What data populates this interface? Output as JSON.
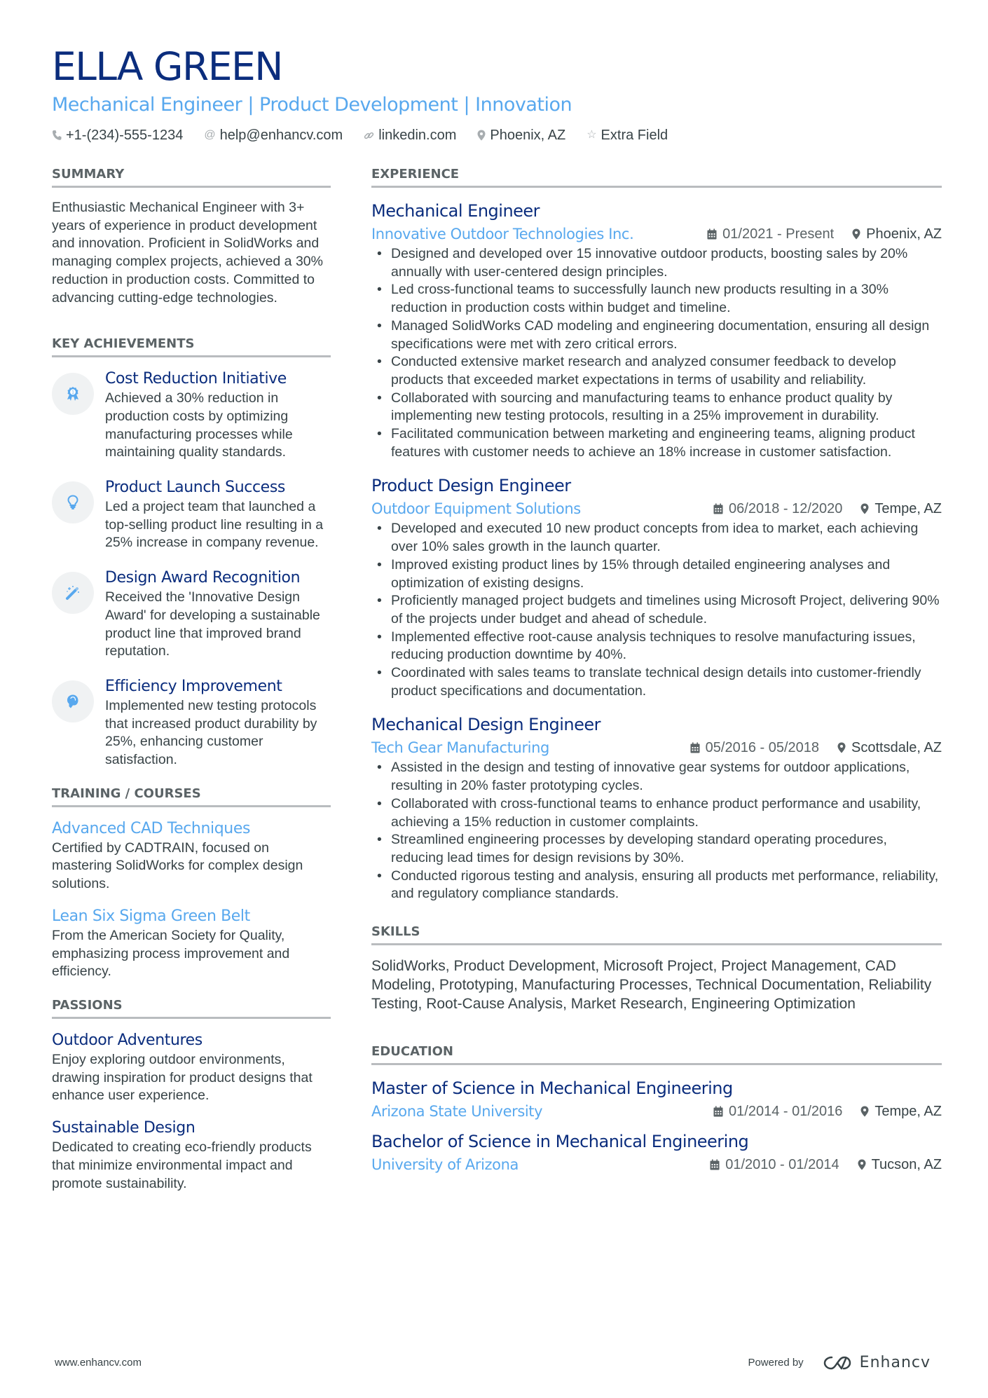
{
  "header": {
    "name": "ELLA GREEN",
    "headline": "Mechanical Engineer | Product Development | Innovation",
    "contacts": [
      {
        "icon": "phone-icon",
        "text": "+1-(234)-555-1234"
      },
      {
        "icon": "at-icon",
        "text": "help@enhancv.com"
      },
      {
        "icon": "link-icon",
        "text": "linkedin.com"
      },
      {
        "icon": "location-pin-icon",
        "text": "Phoenix, AZ"
      },
      {
        "icon": "star-icon",
        "text": "Extra Field"
      }
    ]
  },
  "summary": {
    "title": "SUMMARY",
    "text": "Enthusiastic Mechanical Engineer with 3+ years of experience in product development and innovation. Proficient in SolidWorks and managing complex projects, achieved a 30% reduction in production costs. Committed to advancing cutting-edge technologies."
  },
  "achievements": {
    "title": "KEY ACHIEVEMENTS",
    "items": [
      {
        "icon": "award-ribbon-icon",
        "title": "Cost Reduction Initiative",
        "text": "Achieved a 30% reduction in production costs by optimizing manufacturing processes while maintaining quality standards."
      },
      {
        "icon": "lightbulb-icon",
        "title": "Product Launch Success",
        "text": "Led a project team that launched a top-selling product line resulting in a 25% increase in company revenue."
      },
      {
        "icon": "magic-wand-icon",
        "title": "Design Award Recognition",
        "text": "Received the 'Innovative Design Award' for developing a sustainable product line that improved brand reputation."
      },
      {
        "icon": "head-brain-icon",
        "title": "Efficiency Improvement",
        "text": "Implemented new testing protocols that increased product durability by 25%, enhancing customer satisfaction."
      }
    ]
  },
  "training": {
    "title": "TRAINING / COURSES",
    "items": [
      {
        "title": "Advanced CAD Techniques",
        "text": "Certified by CADTRAIN, focused on mastering SolidWorks for complex design solutions."
      },
      {
        "title": "Lean Six Sigma Green Belt",
        "text": "From the American Society for Quality, emphasizing process improvement and efficiency."
      }
    ]
  },
  "passions": {
    "title": "PASSIONS",
    "items": [
      {
        "title": "Outdoor Adventures",
        "text": "Enjoy exploring outdoor environments, drawing inspiration for product designs that enhance user experience."
      },
      {
        "title": "Sustainable Design",
        "text": "Dedicated to creating eco-friendly products that minimize environmental impact and promote sustainability."
      }
    ]
  },
  "experience": {
    "title": "EXPERIENCE",
    "jobs": [
      {
        "title": "Mechanical Engineer",
        "company": "Innovative Outdoor Technologies Inc.",
        "dates": "01/2021 - Present",
        "location": "Phoenix, AZ",
        "bullets": [
          "Designed and developed over 15 innovative outdoor products, boosting sales by 20% annually with user-centered design principles.",
          "Led cross-functional teams to successfully launch new products resulting in a 30% reduction in production costs within budget and timeline.",
          "Managed SolidWorks CAD modeling and engineering documentation, ensuring all design specifications were met with zero critical errors.",
          "Conducted extensive market research and analyzed consumer feedback to develop products that exceeded market expectations in terms of usability and reliability.",
          "Collaborated with sourcing and manufacturing teams to enhance product quality by implementing new testing protocols, resulting in a 25% improvement in durability.",
          "Facilitated communication between marketing and engineering teams, aligning product features with customer needs to achieve an 18% increase in customer satisfaction."
        ]
      },
      {
        "title": "Product Design Engineer",
        "company": "Outdoor Equipment Solutions",
        "dates": "06/2018 - 12/2020",
        "location": "Tempe, AZ",
        "bullets": [
          "Developed and executed 10 new product concepts from idea to market, each achieving over 10% sales growth in the launch quarter.",
          "Improved existing product lines by 15% through detailed engineering analyses and optimization of existing designs.",
          "Proficiently managed project budgets and timelines using Microsoft Project, delivering 90% of the projects under budget and ahead of schedule.",
          "Implemented effective root-cause analysis techniques to resolve manufacturing issues, reducing production downtime by 40%.",
          "Coordinated with sales teams to translate technical design details into customer-friendly product specifications and documentation."
        ]
      },
      {
        "title": "Mechanical Design Engineer",
        "company": "Tech Gear Manufacturing",
        "dates": "05/2016 - 05/2018",
        "location": "Scottsdale, AZ",
        "bullets": [
          "Assisted in the design and testing of innovative gear systems for outdoor applications, resulting in 20% faster prototyping cycles.",
          "Collaborated with cross-functional teams to enhance product performance and usability, achieving a 15% reduction in customer complaints.",
          "Streamlined engineering processes by developing standard operating procedures, reducing lead times for design revisions by 30%.",
          "Conducted rigorous testing and analysis, ensuring all products met performance, reliability, and regulatory compliance standards."
        ]
      }
    ]
  },
  "skills": {
    "title": "SKILLS",
    "text": "SolidWorks, Product Development, Microsoft Project, Project Management, CAD Modeling, Prototyping, Manufacturing Processes, Technical Documentation, Reliability Testing, Root-Cause Analysis, Market Research, Engineering Optimization"
  },
  "education": {
    "title": "EDUCATION",
    "items": [
      {
        "degree": "Master of Science in Mechanical Engineering",
        "school": "Arizona State University",
        "dates": "01/2014 - 01/2016",
        "location": "Tempe, AZ"
      },
      {
        "degree": "Bachelor of Science in Mechanical Engineering",
        "school": "University of Arizona",
        "dates": "01/2010 - 01/2014",
        "location": "Tucson, AZ"
      }
    ]
  },
  "footer": {
    "website": "www.enhancv.com",
    "powered_by": "Powered by",
    "brand": "Enhancv"
  },
  "colors": {
    "name": "#0b2d7d",
    "accent": "#58a8ee",
    "text": "#384347",
    "rule": "#b9bcbf",
    "icon_bg": "#f0f2f3"
  }
}
